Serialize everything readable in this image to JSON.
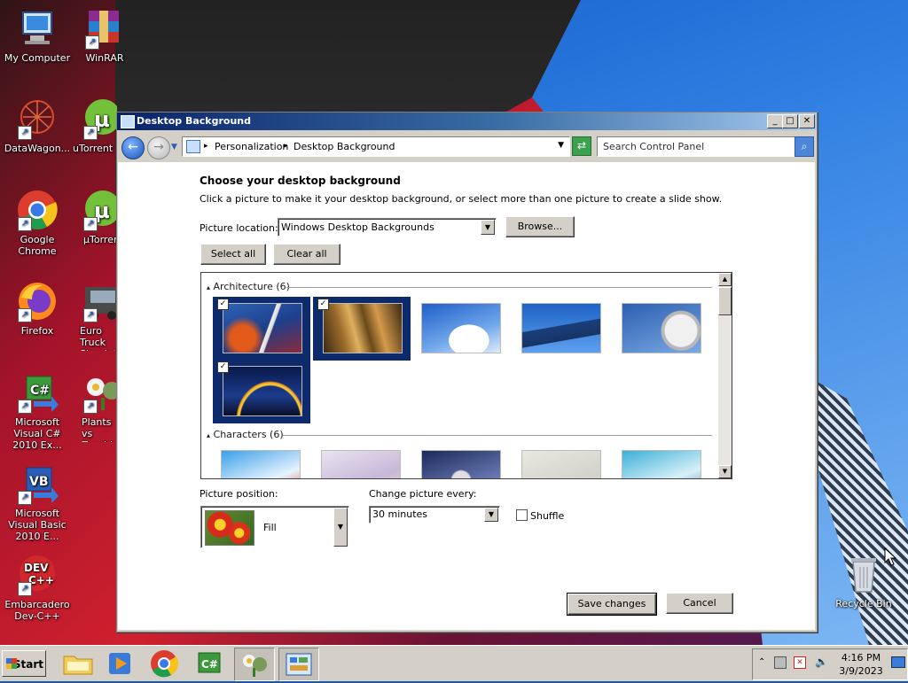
{
  "window": {
    "title": "Desktop Background",
    "address": [
      "Personalization",
      "Desktop Background"
    ],
    "search_placeholder": "Search Control Panel"
  },
  "content": {
    "heading": "Choose your desktop background",
    "description": "Click a picture to make it your desktop background, or select more than one picture to create a slide show.",
    "picture_location_label": "Picture location:",
    "picture_location_value": "Windows Desktop Backgrounds",
    "browse_label": "Browse...",
    "select_all_label": "Select all",
    "clear_all_label": "Clear all",
    "groups": [
      {
        "name": "Architecture (6)",
        "items": 6,
        "selected": [
          true,
          true,
          false,
          false,
          false,
          true
        ]
      },
      {
        "name": "Characters (6)",
        "items": 6
      }
    ],
    "picture_position_label": "Picture position:",
    "picture_position_value": "Fill",
    "change_picture_label": "Change picture every:",
    "change_picture_value": "30 minutes",
    "shuffle_label": "Shuffle",
    "shuffle_checked": false,
    "save_label": "Save changes",
    "cancel_label": "Cancel"
  },
  "desktop_icons": [
    {
      "label": "My Computer"
    },
    {
      "label": "WinRAR"
    },
    {
      "label": "DataWagon..."
    },
    {
      "label": "uTorrent"
    },
    {
      "label": "Google Chrome"
    },
    {
      "label": "µTorrent"
    },
    {
      "label": "Firefox"
    },
    {
      "label": "Euro Truck Simulator"
    },
    {
      "label": "Microsoft Visual C# 2010 Ex..."
    },
    {
      "label": "Plants vs Zombies"
    },
    {
      "label": "Microsoft Visual Basic 2010 E..."
    },
    {
      "label": "Embarcadero Dev-C++"
    },
    {
      "label": "Recycle Bin"
    }
  ],
  "taskbar": {
    "start_label": "Start",
    "clock_time": "4:16 PM",
    "clock_date": "3/9/2023"
  }
}
